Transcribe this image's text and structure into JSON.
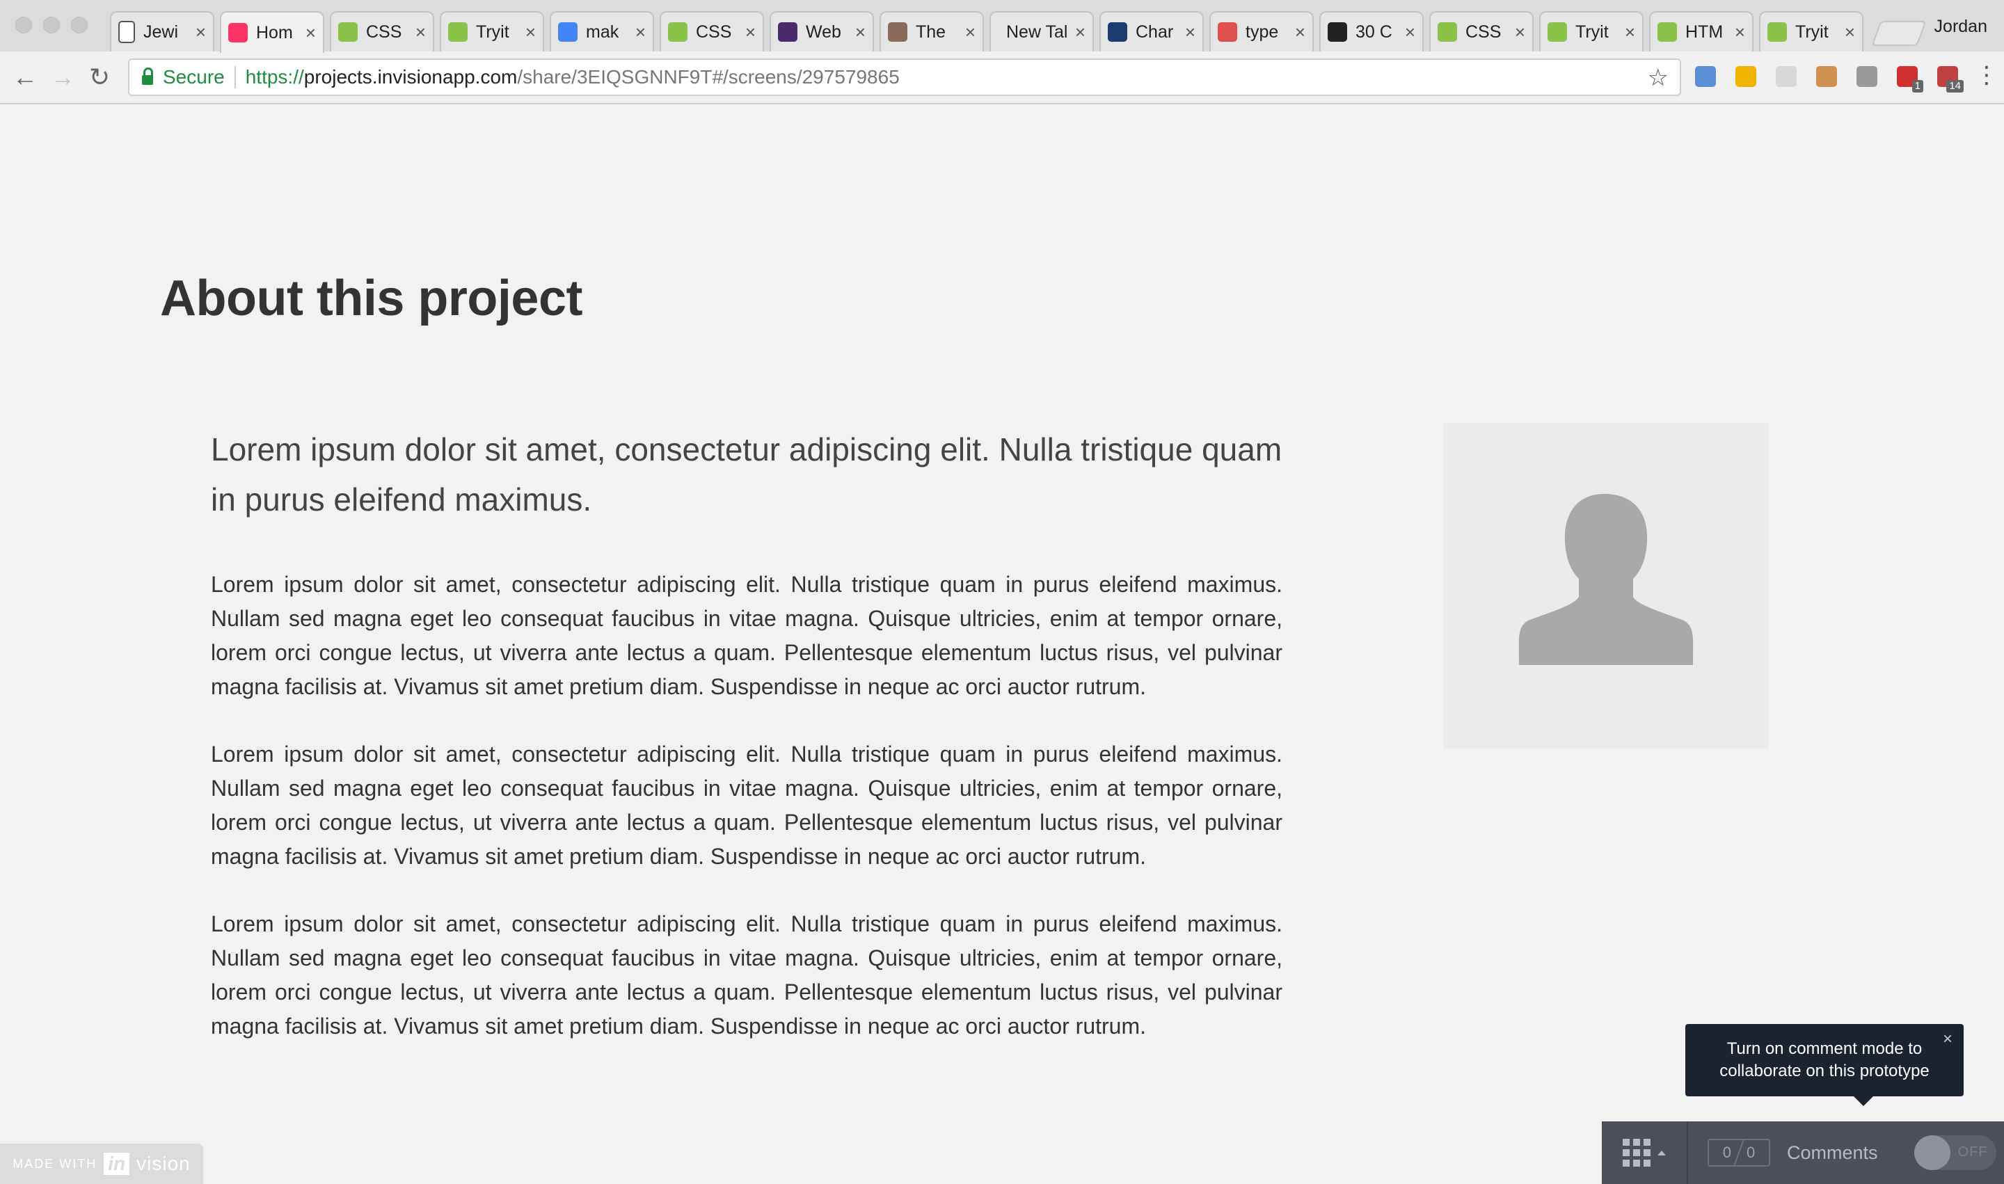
{
  "browser": {
    "profile_name": "Jordan",
    "tabs": [
      {
        "title": "Jewi",
        "favicon": "page-icon",
        "color": "#ffffff",
        "active": false
      },
      {
        "title": "Hom",
        "favicon": "invision-icon",
        "color": "#ff3366",
        "active": true
      },
      {
        "title": "CSS",
        "favicon": "w3schools-icon",
        "color": "#8bc34a",
        "active": false
      },
      {
        "title": "Tryit",
        "favicon": "w3schools-icon",
        "color": "#8bc34a",
        "active": false
      },
      {
        "title": "mak",
        "favicon": "google-icon",
        "color": "#4285f4",
        "active": false
      },
      {
        "title": "CSS",
        "favicon": "w3schools-icon",
        "color": "#8bc34a",
        "active": false
      },
      {
        "title": "Web",
        "favicon": "w-purple-icon",
        "color": "#4b2a6b",
        "active": false
      },
      {
        "title": "The",
        "favicon": "round-logo-icon",
        "color": "#8a6a5a",
        "active": false
      },
      {
        "title": "New Tal",
        "favicon": "none",
        "color": "#e6e6e6",
        "active": false
      },
      {
        "title": "Char",
        "favicon": "circle-logo-icon",
        "color": "#1b3b6f",
        "active": false
      },
      {
        "title": "type",
        "favicon": "ring-icon",
        "color": "#e05050",
        "active": false
      },
      {
        "title": "30 C",
        "favicon": "w-black-icon",
        "color": "#222222",
        "active": false
      },
      {
        "title": "CSS",
        "favicon": "w3schools-icon",
        "color": "#8bc34a",
        "active": false
      },
      {
        "title": "Tryit",
        "favicon": "w3schools-icon",
        "color": "#8bc34a",
        "active": false
      },
      {
        "title": "HTM",
        "favicon": "w3schools-icon",
        "color": "#8bc34a",
        "active": false
      },
      {
        "title": "Tryit",
        "favicon": "w3schools-icon",
        "color": "#8bc34a",
        "active": false
      }
    ],
    "address": {
      "secure_label": "Secure",
      "scheme": "https://",
      "host": "projects.invisionapp.com",
      "path": "/share/3EIQSGNNF9T#/screens/297579865"
    },
    "extensions": [
      {
        "name": "extension-icon-1",
        "color": "#5b8fd6",
        "badge": ""
      },
      {
        "name": "extension-icon-2",
        "color": "#f0b400",
        "badge": ""
      },
      {
        "name": "extension-icon-3",
        "color": "#d8d8d8",
        "badge": ""
      },
      {
        "name": "extension-icon-4",
        "color": "#d09050",
        "badge": ""
      },
      {
        "name": "extension-icon-5",
        "color": "#9a9a9a",
        "badge": ""
      },
      {
        "name": "adblock-icon",
        "color": "#d03030",
        "badge": "1"
      },
      {
        "name": "calendar-extension-icon",
        "color": "#c04040",
        "badge": "14"
      }
    ]
  },
  "page": {
    "title": "About this project",
    "lead": "Lorem ipsum dolor sit amet, consectetur adipiscing elit. Nulla tristique quam in purus eleifend maximus.",
    "paragraphs": [
      "Lorem ipsum dolor sit amet, consectetur adipiscing elit. Nulla tristique quam in purus eleifend maximus. Nullam sed magna eget leo consequat faucibus in vitae magna. Quisque ultricies, enim at tempor ornare, lorem orci congue lectus, ut viverra ante lectus a quam. Pellentesque elementum luctus risus, vel pulvinar magna facilisis at. Vivamus sit amet pretium diam. Suspendisse in neque ac orci auctor rutrum.",
      "Lorem ipsum dolor sit amet, consectetur adipiscing elit. Nulla tristique quam in purus eleifend maximus. Nullam sed magna eget leo consequat faucibus in vitae magna. Quisque ultricies, enim at tempor ornare, lorem orci congue lectus, ut viverra ante lectus a quam. Pellentesque elementum luctus risus, vel pulvinar magna facilisis at. Vivamus sit amet pretium diam. Suspendisse in neque ac orci auctor rutrum.",
      "Lorem ipsum dolor sit amet, consectetur adipiscing elit. Nulla tristique quam in purus eleifend maximus. Nullam sed magna eget leo consequat faucibus in vitae magna. Quisque ultricies, enim at tempor ornare, lorem orci congue lectus, ut viverra ante lectus a quam. Pellentesque elementum luctus risus, vel pulvinar magna facilisis at. Vivamus sit amet pretium diam. Suspendisse in neque ac orci auctor rutrum."
    ]
  },
  "invision": {
    "made_with": "MADE WITH",
    "logo_in": "in",
    "logo_vision": "vision",
    "tooltip_text": "Turn on comment mode to collaborate on this prototype",
    "comment_count": "0",
    "comment_total": "0",
    "comments_label": "Comments",
    "toggle_state": "OFF"
  }
}
